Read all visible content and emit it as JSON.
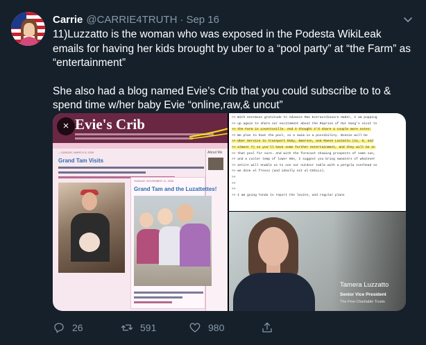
{
  "tweet": {
    "display_name": "Carrie",
    "handle": "@CARRIE4TRUTH",
    "separator": "·",
    "time": "Sep 16",
    "text_paragraph_1": "11)Luzzatto is the woman who was exposed in the Podesta WikiLeak emails for having her kids brought by uber to a “pool party” at “the Farm” as “entertainment”",
    "text_paragraph_2": "She also had a blog named Evie’s Crib that you could subscribe to to & spend time w/her baby Evie “online,raw,& uncut”"
  },
  "media": {
    "close_icon": "×",
    "blog": {
      "title": "Evie's Crib",
      "post1_date": "—SUNDAY, MARCH 5, 2006",
      "post1_title": "Grand Tam Visits",
      "post2_date": "SUNDAY, NOVEMBER 11, 2006",
      "post2_title": "Grand Tam and the Luzattettes!",
      "about_label": "About Me"
    },
    "email_lines": [
      ">> With enormous gratitude to Advance Man Extraordinaire Haber, I am popping",
      ">> up again to share our excitement about the Reprise of Our Gang's visit to",
      ">> the Farm in Lovettsville. And I thought I'd share a couple more notes:",
      ">> We plan to heat the pool, so a swim is a possibility. Bonnie will be",
      ">> Uber Service to transport Ruby, Emerson, and Maeve Luzzatto (11, 9, and",
      ">> almost 7) so you'll have some further entertainment, and they will be in",
      ">> that pool for sure. And with the forecast showing prospects of some sun,",
      ">> and a cooler temp of lower 60s, I suggest you bring sweaters of whatever",
      ">> attire will enable us to use our outdoor table with a pergola overhead so",
      ">> we dine al fresco (and ideally not al-CHILLo).",
      ">>",
      ">>",
      ">>",
      ">> I am going Tonda to report the lovite, and regular plans"
    ],
    "portrait_caption": {
      "name": "Tamera Luzzatto",
      "role": "Senior Vice President",
      "org": "The Pew Charitable Trusts"
    }
  },
  "actions": {
    "reply_count": "26",
    "retweet_count": "591",
    "like_count": "980"
  },
  "colors": {
    "background": "#15202b",
    "secondary_text": "#8899a6",
    "blog_header": "#6a2744",
    "highlight": "#fff27a"
  }
}
